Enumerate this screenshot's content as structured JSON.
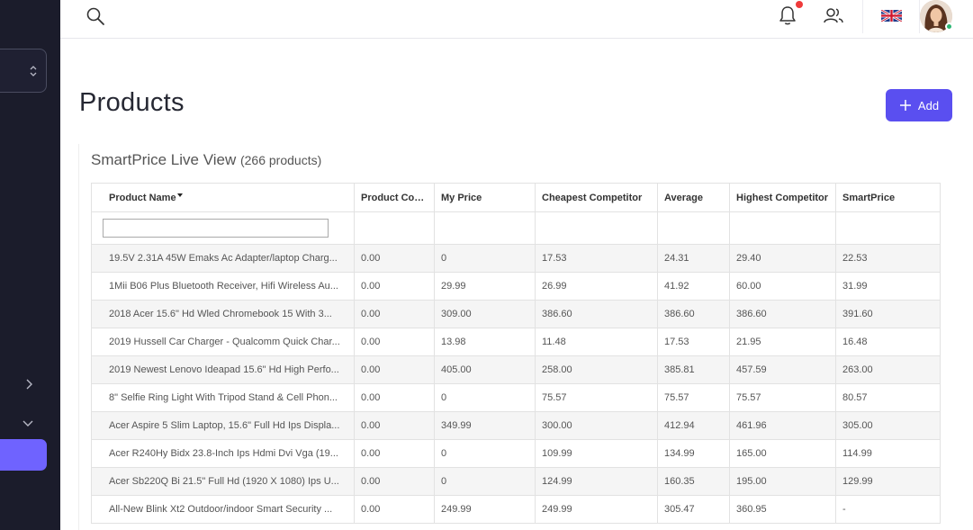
{
  "page": {
    "title": "Products",
    "add_button": "Add"
  },
  "section": {
    "title": "SmartPrice Live View",
    "count": "(266 products)"
  },
  "table": {
    "columns": [
      "Product Name",
      "Product Cost",
      "My Price",
      "Cheapest Competitor",
      "Average",
      "Highest Competitor",
      "SmartPrice"
    ],
    "rows": [
      [
        "19.5V 2.31A 45W Emaks Ac Adapter/laptop Charg...",
        "0.00",
        "0",
        "17.53",
        "24.31",
        "29.40",
        "22.53"
      ],
      [
        "1Mii B06 Plus Bluetooth Receiver, Hifi Wireless Au...",
        "0.00",
        "29.99",
        "26.99",
        "41.92",
        "60.00",
        "31.99"
      ],
      [
        "2018 Acer 15.6\" Hd Wled Chromebook 15 With 3...",
        "0.00",
        "309.00",
        "386.60",
        "386.60",
        "386.60",
        "391.60"
      ],
      [
        "2019 Hussell Car Charger - Qualcomm Quick Char...",
        "0.00",
        "13.98",
        "11.48",
        "17.53",
        "21.95",
        "16.48"
      ],
      [
        "2019 Newest Lenovo Ideapad 15.6\" Hd High Perfo...",
        "0.00",
        "405.00",
        "258.00",
        "385.81",
        "457.59",
        "263.00"
      ],
      [
        "8\" Selfie Ring Light With Tripod Stand & Cell Phon...",
        "0.00",
        "0",
        "75.57",
        "75.57",
        "75.57",
        "80.57"
      ],
      [
        "Acer Aspire 5 Slim Laptop, 15.6\" Full Hd Ips Displa...",
        "0.00",
        "349.99",
        "300.00",
        "412.94",
        "461.96",
        "305.00"
      ],
      [
        "Acer R240Hy Bidx 23.8-Inch Ips Hdmi Dvi Vga (19...",
        "0.00",
        "0",
        "109.99",
        "134.99",
        "165.00",
        "114.99"
      ],
      [
        "Acer Sb220Q Bi 21.5\" Full Hd (1920 X 1080) Ips U...",
        "0.00",
        "0",
        "124.99",
        "160.35",
        "195.00",
        "129.99"
      ],
      [
        "All-New Blink Xt2 Outdoor/indoor Smart Security ...",
        "0.00",
        "249.99",
        "249.99",
        "305.47",
        "360.95",
        "-"
      ]
    ]
  },
  "colors": {
    "sidebar": "#1b1c2b",
    "accent": "#5a4ff0",
    "sidebar_active": "#6f63ff",
    "notification_dot": "#ef3b3b",
    "online": "#2bb673"
  },
  "icons": {
    "header": [
      "search-icon",
      "bell-icon",
      "users-icon",
      "uk-flag-icon",
      "avatar"
    ],
    "sidebar": [
      "updown-icon",
      "chevron-right-icon",
      "chevron-down-icon"
    ],
    "add": "plus-icon"
  }
}
